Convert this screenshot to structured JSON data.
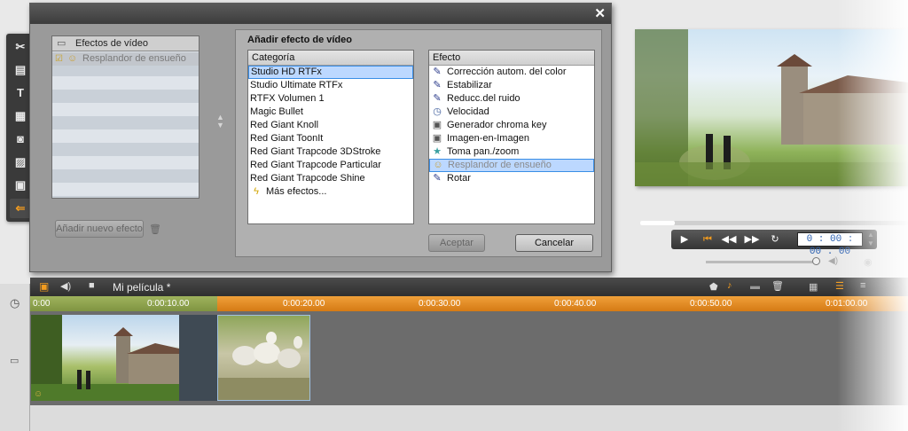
{
  "dialog": {
    "close_symbol": "✕",
    "effects_list": {
      "header": "Efectos de vídeo",
      "items": [
        "Resplandor de ensueño"
      ]
    },
    "add_new_effect": "Añadir nuevo efecto",
    "add_panel_title": "Añadir efecto de vídeo",
    "category": {
      "header": "Categoría",
      "items": [
        "Studio HD RTFx",
        "Studio Ultimate RTFx",
        "RTFX Volumen 1",
        "Magic Bullet",
        "Red Giant Knoll",
        "Red Giant ToonIt",
        "Red Giant Trapcode 3DStroke",
        "Red Giant Trapcode Particular",
        "Red Giant Trapcode Shine",
        "Más efectos..."
      ],
      "selected": "Studio HD RTFx"
    },
    "effect": {
      "header": "Efecto",
      "items": [
        "Corrección autom. del color",
        "Estabilizar",
        "Reducc.del ruido",
        "Velocidad",
        "Generador chroma key",
        "Imagen-en-Imagen",
        "Toma pan./zoom",
        "Resplandor de ensueño",
        "Rotar"
      ],
      "selected": "Resplandor de ensueño"
    },
    "accept_label": "Aceptar",
    "cancel_label": "Cancelar"
  },
  "player": {
    "timecode": "0 : 00 : 00 . 00",
    "scrub_progress": 0.13,
    "volume": 0.97
  },
  "timeline": {
    "title": "Mi película *",
    "ticks": [
      "0:00",
      "0:00:10.00",
      "0:00:20.00",
      "0:00:30.00",
      "0:00:40.00",
      "0:00:50.00",
      "0:01:00.00"
    ]
  },
  "colors": {
    "accent": "#e8921f",
    "selection": "#3a8ee6"
  }
}
